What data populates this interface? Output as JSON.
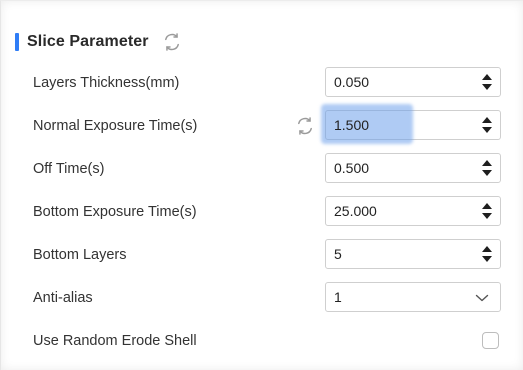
{
  "section": {
    "title": "Slice Parameter",
    "accent_color": "#2f7df6",
    "header_icon": "refresh-icon"
  },
  "params": [
    {
      "label": "Layers Thickness(mm)",
      "value": "0.050",
      "control": "spinbox"
    },
    {
      "label": "Normal Exposure Time(s)",
      "value": "1.500",
      "control": "spinbox",
      "focused": true,
      "reset_icon": "refresh-icon"
    },
    {
      "label": "Off Time(s)",
      "value": "0.500",
      "control": "spinbox"
    },
    {
      "label": "Bottom Exposure Time(s)",
      "value": "25.000",
      "control": "spinbox"
    },
    {
      "label": "Bottom Layers",
      "value": "5",
      "control": "spinbox"
    },
    {
      "label": "Anti-alias",
      "value": "1",
      "control": "select",
      "icon": "chevron-down-icon"
    },
    {
      "label": "Use Random Erode Shell",
      "checked": false,
      "control": "checkbox"
    }
  ]
}
